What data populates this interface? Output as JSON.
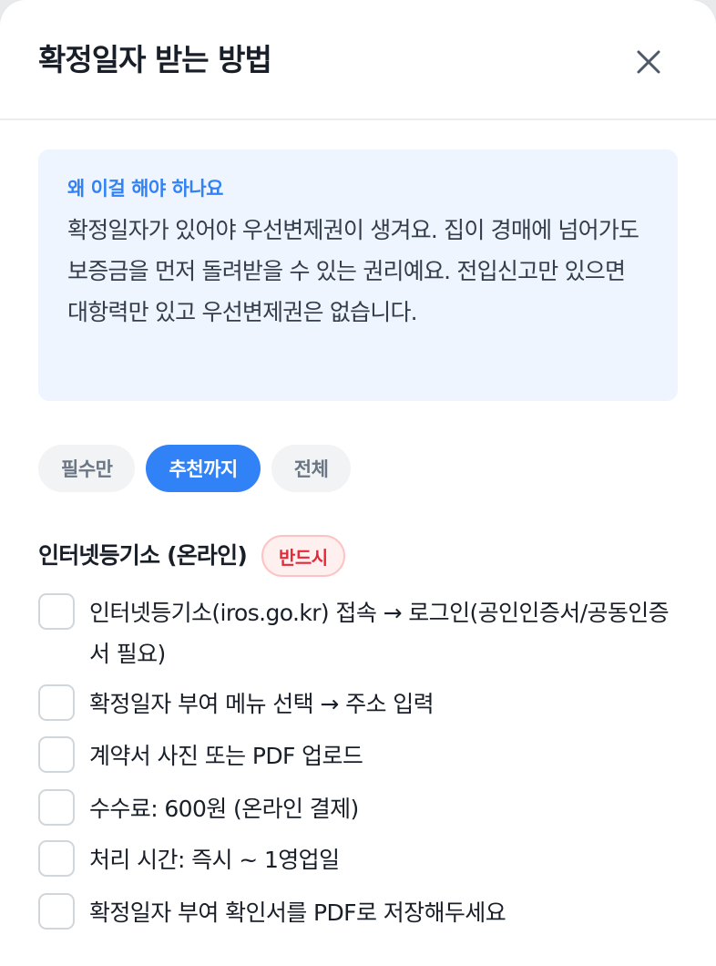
{
  "dialog": {
    "title": "확정일자 받는 방법",
    "close_icon": "close-icon"
  },
  "info": {
    "label": "왜 이걸 해야 하나요",
    "body": "확정일자가 있어야 우선변제권이 생겨요. 집이 경매에 넘어가도 보증금을 먼저 돌려받을 수 있는 권리예요. 전입신고만 있으면 대항력만 있고 우선변제권은 없습니다."
  },
  "filters": {
    "items": [
      "필수만",
      "추천까지",
      "전체"
    ],
    "selected": "추천까지"
  },
  "section": {
    "title": "인터넷등기소 (온라인)",
    "badge": "반드시"
  },
  "checklist": [
    "인터넷등기소(iros.go.kr) 접속 → 로그인(공인인증서/공동인증서 필요)",
    "확정일자 부여 메뉴 선택 → 주소 입력",
    "계약서 사진 또는 PDF 업로드",
    "수수료: 600원 (온라인 결제)",
    "처리 시간: 즉시 ~ 1영업일",
    "확정일자 부여 확인서를 PDF로 저장해두세요"
  ],
  "colors": {
    "accent": "#3182f6",
    "info_bg": "#eef5fe",
    "badge_text": "#e42939",
    "badge_bg": "#fff0f0"
  }
}
